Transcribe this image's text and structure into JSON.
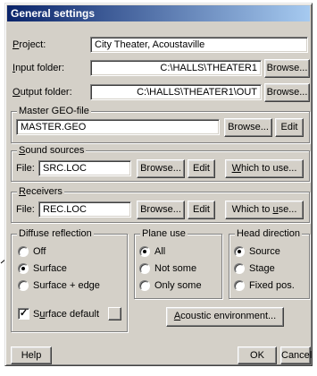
{
  "window": {
    "title": "General settings"
  },
  "project": {
    "label": "Project:",
    "value": "City Theater, Acoustaville"
  },
  "input_folder": {
    "label": "Input folder:",
    "value": "C:\\HALLS\\THEATER1",
    "browse_label": "Browse..."
  },
  "output_folder": {
    "label": "Output folder:",
    "value": "C:\\HALLS\\THEATER1\\OUT",
    "browse_label": "Browse..."
  },
  "master_geo": {
    "title": "Master GEO-file",
    "value": "MASTER.GEO",
    "browse_label": "Browse...",
    "edit_label": "Edit"
  },
  "sound_sources": {
    "title": "Sound sources",
    "file_label": "File:",
    "value": "SRC.LOC",
    "browse_label": "Browse...",
    "edit_label": "Edit",
    "which_label": "Which to use..."
  },
  "receivers": {
    "title": "Receivers",
    "file_label": "File:",
    "value": "REC.LOC",
    "browse_label": "Browse...",
    "edit_label": "Edit",
    "which_label": "Which to use..."
  },
  "diffuse_reflection": {
    "title": "Diffuse reflection",
    "options": [
      "Off",
      "Surface",
      "Surface + edge"
    ],
    "selected": "Surface",
    "surface_default_label": "Surface default",
    "surface_default_checked": true
  },
  "plane_use": {
    "title": "Plane use",
    "options": [
      "All",
      "Not some",
      "Only some"
    ],
    "selected": "All"
  },
  "head_direction": {
    "title": "Head direction",
    "options": [
      "Source",
      "Stage",
      "Fixed pos."
    ],
    "selected": "Source"
  },
  "acoustic_env_label": "Acoustic environment...",
  "buttons": {
    "help": "Help",
    "ok": "OK",
    "cancel": "Cancel"
  },
  "colors": {
    "title_start": "#0a246a",
    "title_end": "#a6caf0",
    "face": "#d4d0c8"
  }
}
